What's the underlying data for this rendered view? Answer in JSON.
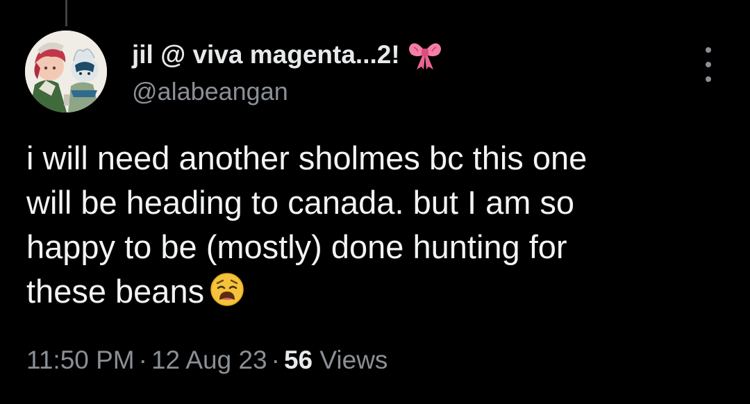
{
  "author": {
    "display_name": "jil @ viva magenta...2!",
    "handle": "@alabeangan",
    "name_emoji": "ribbon-bow-icon",
    "avatar": "avatar"
  },
  "tweet": {
    "lines": [
      "i will need another sholmes bc this one",
      "will be heading to canada. but I am so",
      "happy to be (mostly) done hunting for",
      "these beans"
    ],
    "trailing_emoji": "weary-face-icon"
  },
  "meta": {
    "time": "11:50 PM",
    "separator": "·",
    "date": "12 Aug 23",
    "views_count": "56",
    "views_label": "Views"
  },
  "actions": {
    "more_icon": "more-vertical-icon"
  },
  "colors": {
    "background": "#000000",
    "primary_text": "#e7e9ea",
    "secondary_text": "#8b9096",
    "bow": "#f57ea8",
    "emoji_yellow": "#f5c33b"
  }
}
